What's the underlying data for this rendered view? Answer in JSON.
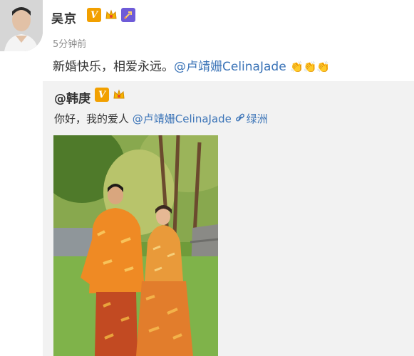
{
  "post": {
    "author": "吴京",
    "time": "5分钟前",
    "text": "新婚快乐，相爱永远。",
    "mention": "@卢靖姗CelinaJade",
    "emoji": "👏👏👏"
  },
  "repost": {
    "author": "@韩庚",
    "text": "你好，我的爱人 ",
    "mention": "@卢靖姗CelinaJade",
    "location": "绿洲"
  },
  "icons": [
    "verified-v-icon",
    "crown-badge-icon",
    "rocket-badge-icon",
    "link-icon",
    "clap-emoji"
  ],
  "colors": {
    "link": "#3a73b7",
    "badge_gold": "#f2a000",
    "repost_bg": "#f2f2f2"
  }
}
